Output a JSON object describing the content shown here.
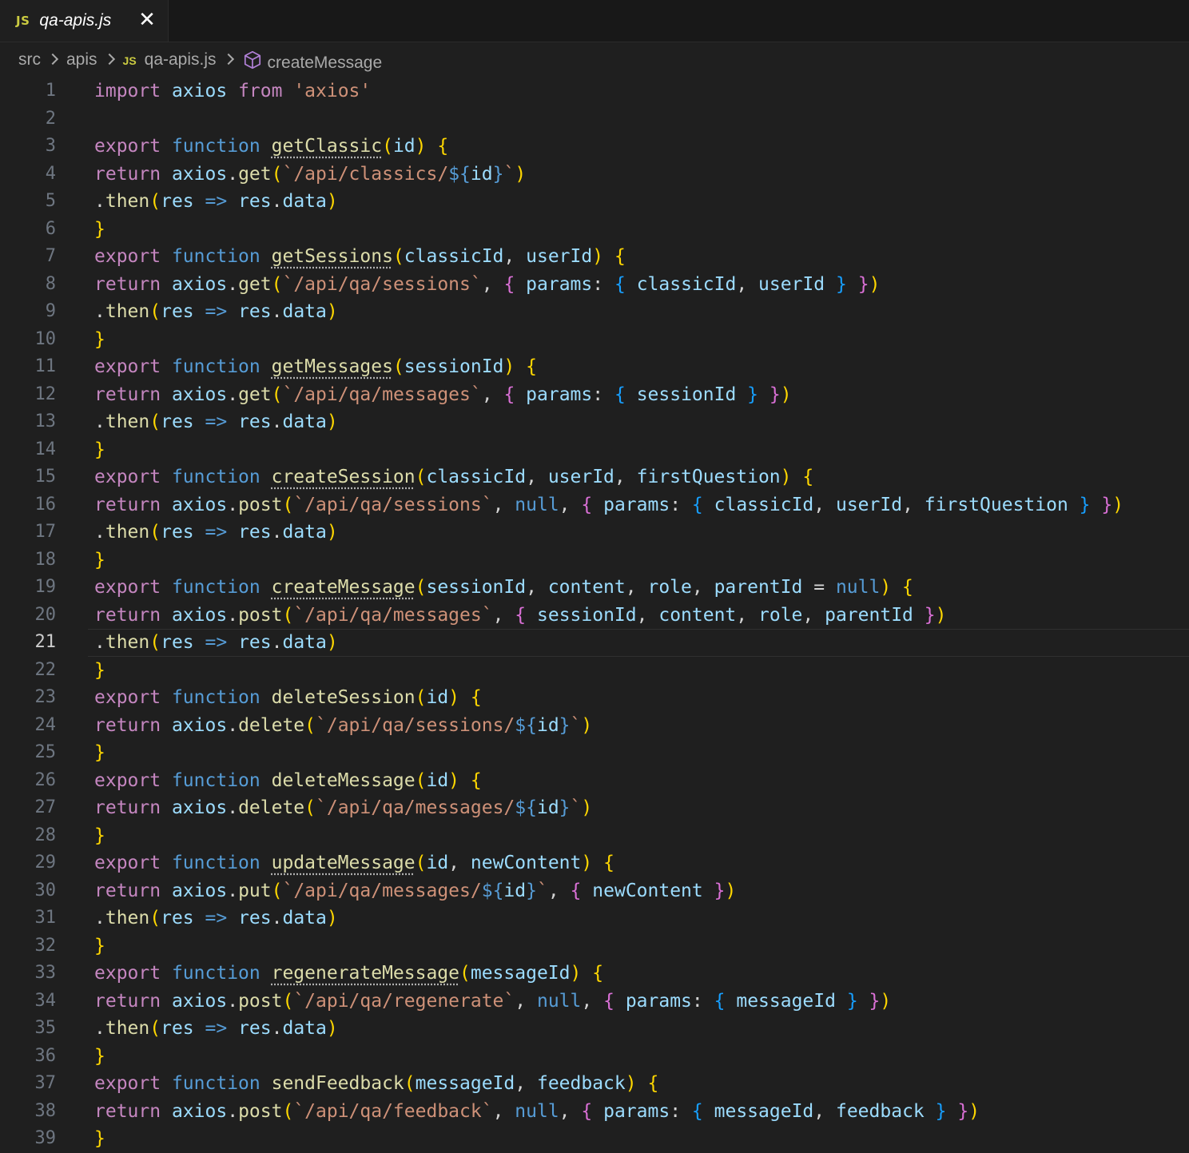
{
  "tab": {
    "badge": "JS",
    "title": "qa-apis.js"
  },
  "breadcrumb": {
    "items": [
      "src",
      "apis",
      "qa-apis.js",
      "createMessage"
    ],
    "file_badge": "JS"
  },
  "editor": {
    "current_line": 21,
    "lines": [
      "import axios from 'axios'",
      "",
      "export function getClassic(id) {",
      "return axios.get(`/api/classics/${id}`)",
      ".then(res => res.data)",
      "}",
      "export function getSessions(classicId, userId) {",
      "return axios.get(`/api/qa/sessions`, { params: { classicId, userId } })",
      ".then(res => res.data)",
      "}",
      "export function getMessages(sessionId) {",
      "return axios.get(`/api/qa/messages`, { params: { sessionId } })",
      ".then(res => res.data)",
      "}",
      "export function createSession(classicId, userId, firstQuestion) {",
      "return axios.post(`/api/qa/sessions`, null, { params: { classicId, userId, firstQuestion } })",
      ".then(res => res.data)",
      "}",
      "export function createMessage(sessionId, content, role, parentId = null) {",
      "return axios.post(`/api/qa/messages`, { sessionId, content, role, parentId })",
      ".then(res => res.data)",
      "}",
      "export function deleteSession(id) {",
      "return axios.delete(`/api/qa/sessions/${id}`)",
      "}",
      "export function deleteMessage(id) {",
      "return axios.delete(`/api/qa/messages/${id}`)",
      "}",
      "export function updateMessage(id, newContent) {",
      "return axios.put(`/api/qa/messages/${id}`, { newContent })",
      ".then(res => res.data)",
      "}",
      "export function regenerateMessage(messageId) {",
      "return axios.post(`/api/qa/regenerate`, null, { params: { messageId } })",
      ".then(res => res.data)",
      "}",
      "export function sendFeedback(messageId, feedback) {",
      "return axios.post(`/api/qa/feedback`, null, { params: { messageId, feedback } })",
      "}"
    ]
  }
}
